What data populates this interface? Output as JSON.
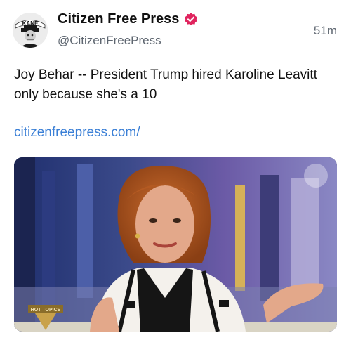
{
  "post": {
    "author_name": "Citizen Free Press",
    "handle": "@CitizenFreePress",
    "timestamp": "51m",
    "text": "Joy Behar -- President Trump hired Karoline Leavitt only because she's a 10",
    "link_text": "citizenfreepress.com/"
  },
  "avatar": {
    "logo_text": "KANE"
  },
  "media": {
    "lower_third_text": "HOT TOPICS"
  },
  "colors": {
    "verified_badge": "#e0245e",
    "link": "#3a7fd6",
    "secondary_text": "#5e6670"
  },
  "icons": [
    "verified-badge-icon",
    "network-watermark-icon",
    "show-logo-icon"
  ]
}
